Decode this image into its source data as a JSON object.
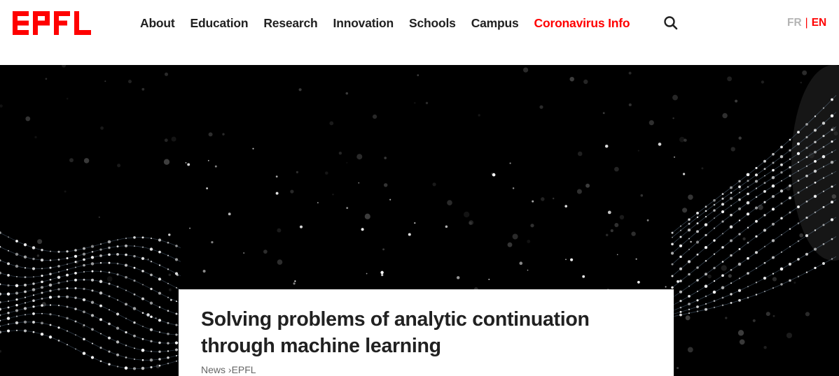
{
  "brand": {
    "logo_text": "EPFL",
    "color": "#ff0000"
  },
  "nav": {
    "items": [
      {
        "label": "About"
      },
      {
        "label": "Education"
      },
      {
        "label": "Research"
      },
      {
        "label": "Innovation"
      },
      {
        "label": "Schools"
      },
      {
        "label": "Campus"
      },
      {
        "label": "Coronavirus Info"
      }
    ],
    "search_icon": "search-icon"
  },
  "lang": {
    "fr": "FR",
    "separator": "|",
    "en": "EN"
  },
  "article": {
    "title": "Solving problems of analytic continuation through machine learning",
    "breadcrumb": {
      "part1": "News",
      "separator": " ›",
      "part2": "EPFL"
    }
  },
  "colors": {
    "accent": "#ff0000",
    "text": "#212121",
    "hero_background": "#000000"
  }
}
